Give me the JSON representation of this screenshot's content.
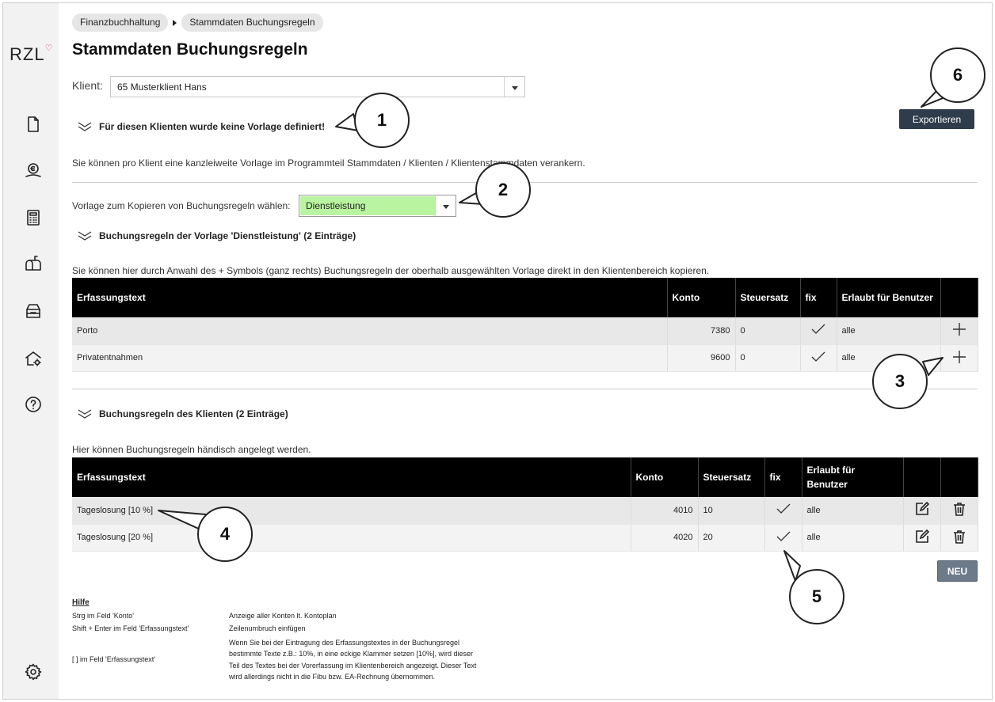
{
  "app": {
    "logo": "RZL"
  },
  "breadcrumb": [
    "Finanzbuchhaltung",
    "Stammdaten Buchungsregeln"
  ],
  "page_title": "Stammdaten Buchungsregeln",
  "klient": {
    "label": "Klient:",
    "value": "65 Musterklient Hans"
  },
  "vorlage_section": {
    "header": "Für diesen Klienten wurde keine Vorlage definiert!",
    "info": "Sie können pro Klient eine kanzleiweite Vorlage im Programmteil Stammdaten / Klienten / Klientenstammdaten verankern."
  },
  "export_button": "Exportieren",
  "vorlage_select": {
    "label": "Vorlage zum Kopieren von Buchungsregeln wählen:",
    "value": "Dienstleistung",
    "highlight": "#b9f5a0"
  },
  "template_rules": {
    "header": "Buchungsregeln der Vorlage 'Dienstleistung' (2 Einträge)",
    "info": "Sie können hier durch Anwahl des + Symbols (ganz rechts) Buchungsregeln der oberhalb ausgewählten Vorlage direkt in den Klientenbereich kopieren.",
    "columns": [
      "Erfassungstext",
      "Konto",
      "Steuersatz",
      "fix",
      "Erlaubt für Benutzer"
    ],
    "rows": [
      {
        "text": "Porto",
        "konto": "7380",
        "steuersatz": "0",
        "benutzer": "alle"
      },
      {
        "text": "Privatentnahmen",
        "konto": "9600",
        "steuersatz": "0",
        "benutzer": "alle"
      }
    ]
  },
  "client_rules": {
    "header": "Buchungsregeln des Klienten (2 Einträge)",
    "info": "Hier können Buchungsregeln händisch angelegt werden.",
    "columns": [
      "Erfassungstext",
      "Konto",
      "Steuersatz",
      "fix",
      "Erlaubt für Benutzer"
    ],
    "rows": [
      {
        "text": "Tageslosung [10 %]",
        "konto": "4010",
        "steuersatz": "10",
        "benutzer": "alle"
      },
      {
        "text": "Tageslosung [20 %]",
        "konto": "4020",
        "steuersatz": "20",
        "benutzer": "alle"
      }
    ]
  },
  "new_button": "NEU",
  "help": {
    "title": "Hilfe",
    "items": [
      {
        "key": "Strg im Feld 'Konto'",
        "desc": "Anzeige aller Konten lt. Kontoplan"
      },
      {
        "key": "Shift + Enter im Feld 'Erfassungstext'",
        "desc": "Zeilenumbruch einfügen"
      },
      {
        "key": "[ ] im Feld 'Erfassungstext'",
        "desc": "Wenn Sie bei der Eintragung des Erfassungstextes in der Buchungsregel bestimmte Texte z.B.: 10%, in eine eckige Klammer setzen [10%], wird dieser Teil des Textes bei der Vorerfassung im Klientenbereich angezeigt. Dieser Text wird allerdings nicht in die Fibu bzw. EA-Rechnung übernommen."
      }
    ],
    "desc_lines": [
      "Wenn Sie bei der Eintragung des Erfassungstextes in der Buchungsregel",
      "bestimmte Texte z.B.: 10%, in eine eckige Klammer setzen [10%], wird dieser",
      "Teil des Textes bei der Vorerfassung im Klientenbereich angezeigt. Dieser Text",
      "wird allerdings nicht in die Fibu bzw. EA-Rechnung übernommen."
    ]
  },
  "callouts": [
    "1",
    "2",
    "3",
    "4",
    "5",
    "6"
  ],
  "sidebar_icons": [
    "document-icon",
    "money-hand-icon",
    "calculator-icon",
    "mailbox-icon",
    "archive-icon",
    "home-settings-icon",
    "help-icon",
    "settings-icon"
  ]
}
